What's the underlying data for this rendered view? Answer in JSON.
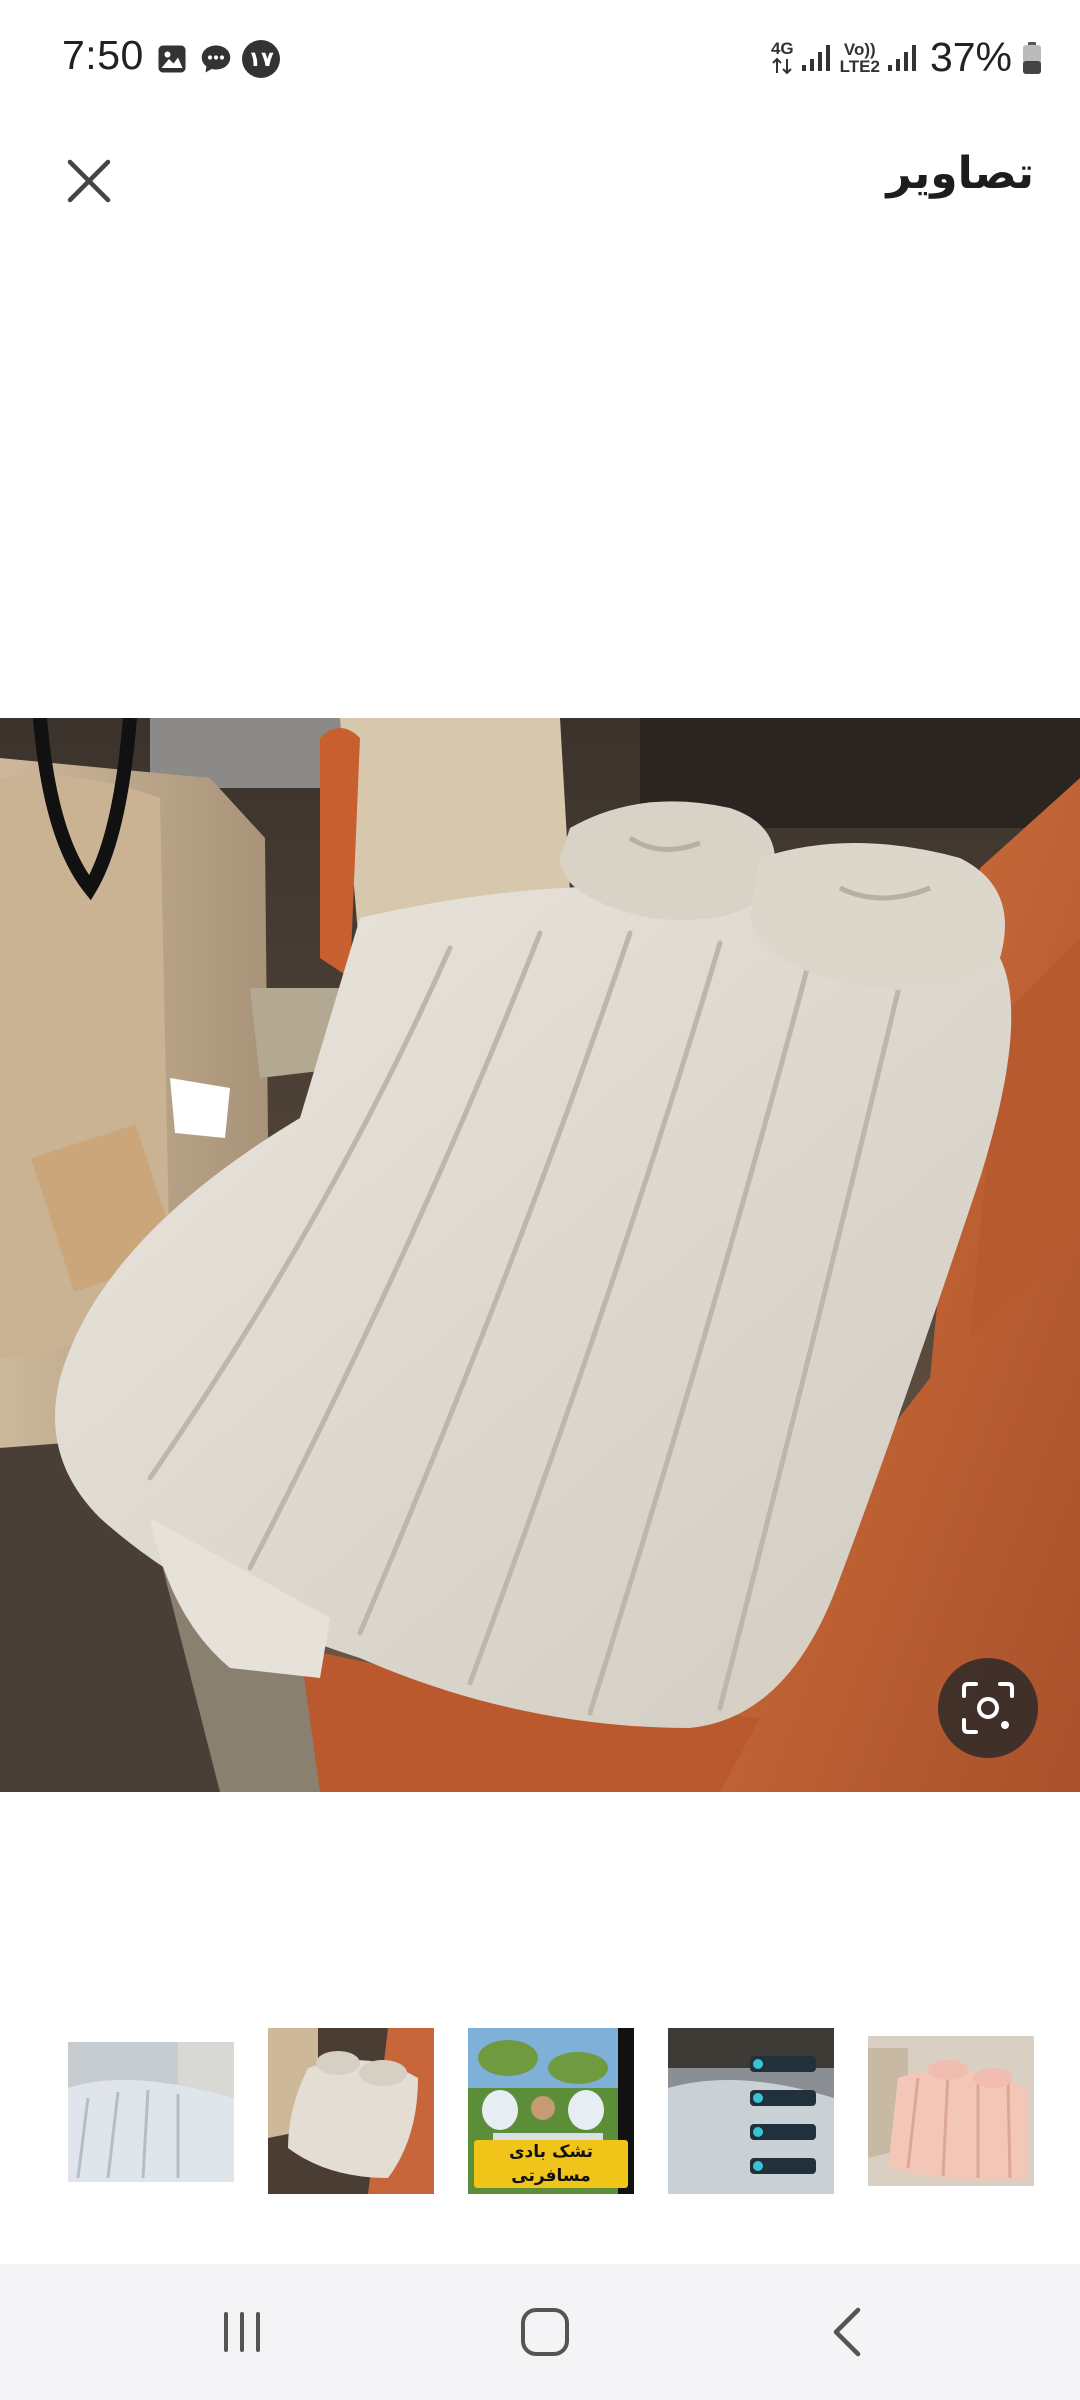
{
  "status_bar": {
    "time": "7:50",
    "notification_count": "۱۷",
    "network_type": "4G",
    "volte_label_top": "Vo))",
    "volte_label_bottom": "LTE2",
    "battery_percent": "37%",
    "icons": [
      "gallery-icon",
      "chat-icon",
      "notification-badge",
      "data-arrows-icon",
      "signal-icon",
      "signal-icon",
      "battery-icon"
    ]
  },
  "header": {
    "title": "تصاویر",
    "close_icon": "close-icon"
  },
  "main_image": {
    "subject": "inflatable car mattress",
    "lens_icon": "visual-search-icon"
  },
  "thumbnails": [
    {
      "id": "thumb-1",
      "caption": ""
    },
    {
      "id": "thumb-2",
      "caption": ""
    },
    {
      "id": "thumb-3",
      "caption": "تشک بادی مسافرتی"
    },
    {
      "id": "thumb-4",
      "caption": ""
    },
    {
      "id": "thumb-5",
      "caption": ""
    }
  ],
  "nav_bar": {
    "icons": [
      "recent-apps-icon",
      "home-icon",
      "back-icon"
    ]
  },
  "colors": {
    "background": "#ffffff",
    "nav_background": "#f4f4f6",
    "mattress": "#ddd8cf",
    "seat_orange": "#c8643a",
    "thumb_caption": "#f0c419"
  }
}
